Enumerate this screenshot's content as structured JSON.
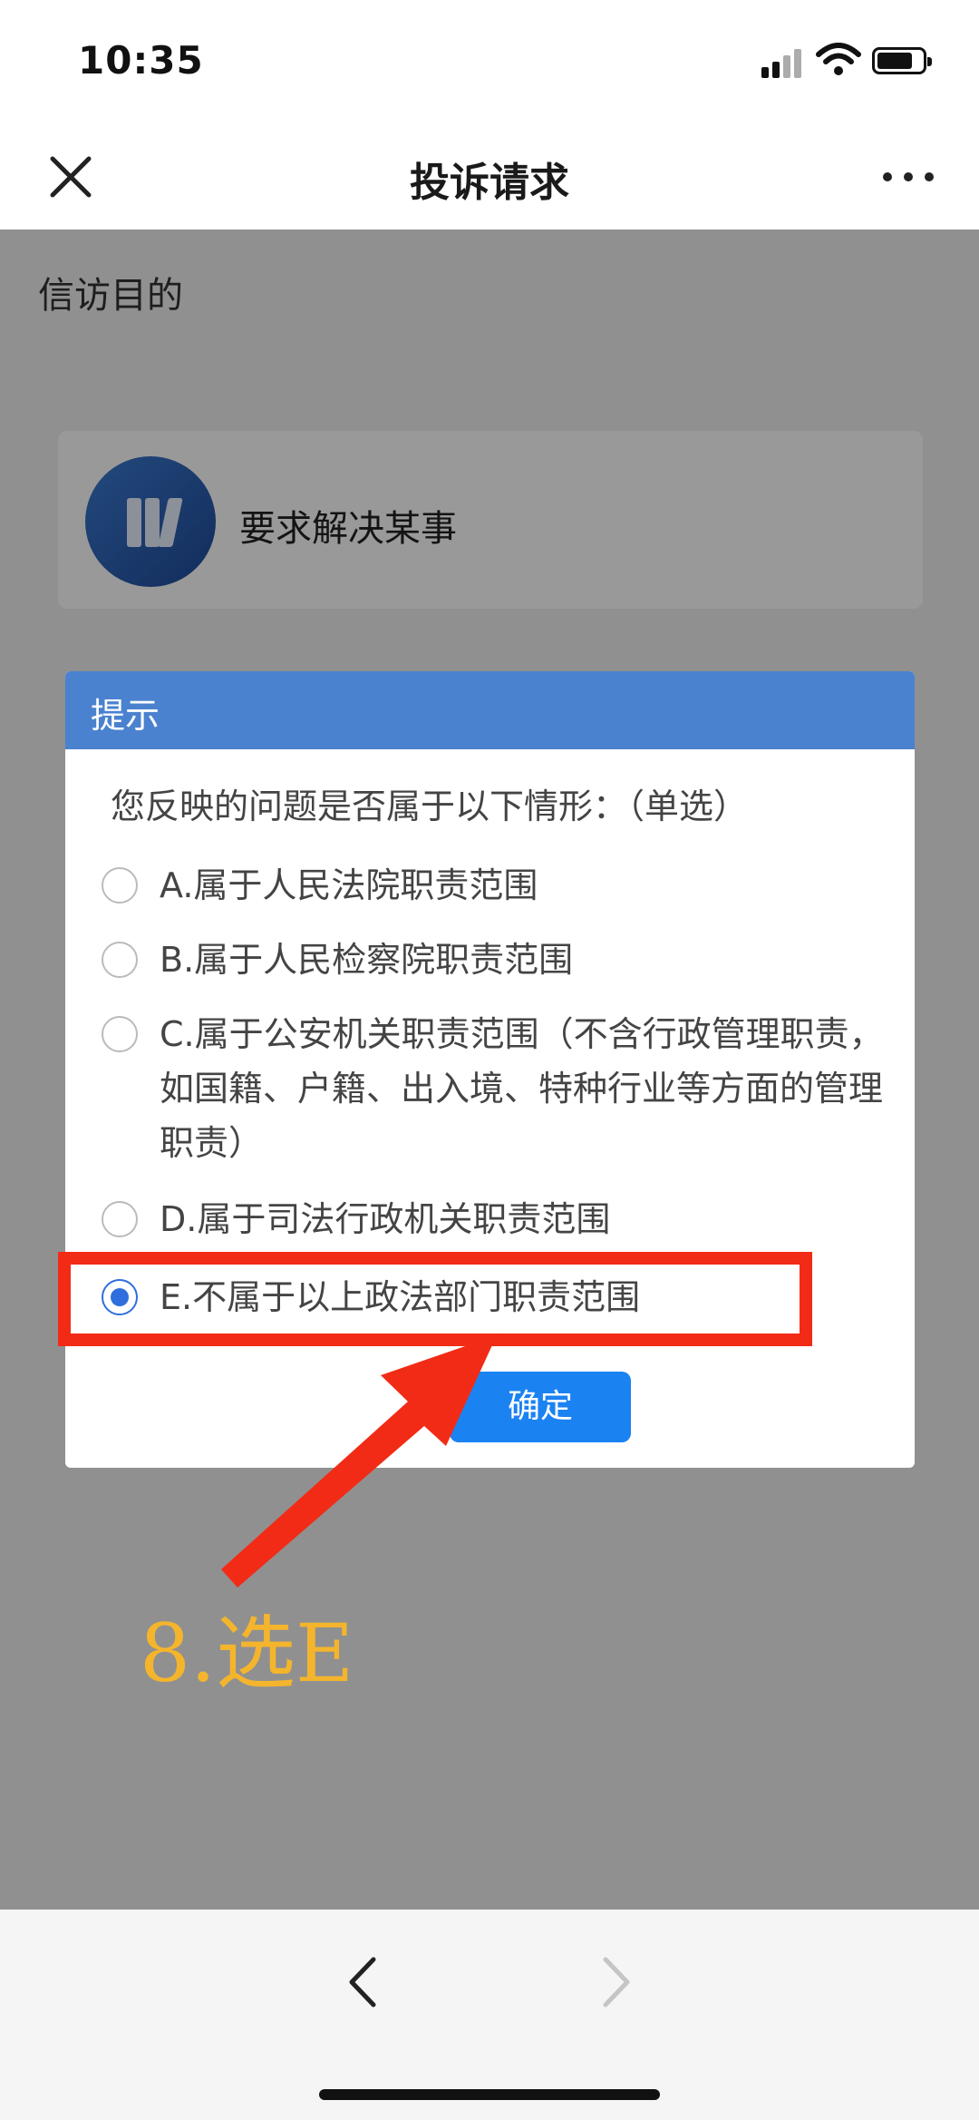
{
  "status_bar": {
    "time": "10:35"
  },
  "nav": {
    "title": "投诉请求",
    "close_icon": "close-icon",
    "more_icon": "more-icon"
  },
  "content": {
    "section_label": "信访目的",
    "card_label": "要求解决某事"
  },
  "dialog": {
    "title": "提示",
    "question": "您反映的问题是否属于以下情形：（单选）",
    "options": [
      {
        "label": "A.属于人民法院职责范围",
        "checked": false
      },
      {
        "label": "B.属于人民检察院职责范围",
        "checked": false
      },
      {
        "label": "C.属于公安机关职责范围（不含行政管理职责，如国籍、户籍、出入境、特种行业等方面的管理职责）",
        "checked": false
      },
      {
        "label": "D.属于司法行政机关职责范围",
        "checked": false
      },
      {
        "label": "E.不属于以上政法部门职责范围",
        "checked": true
      }
    ],
    "confirm_label": "确定"
  },
  "annotation": {
    "step_label": "8.选E",
    "highlight_color": "#f22b16",
    "label_color": "#f4b52d"
  },
  "colors": {
    "header_blue": "#4a82cf",
    "button_blue": "#1b82f2",
    "radio_blue": "#2f6fdd"
  }
}
